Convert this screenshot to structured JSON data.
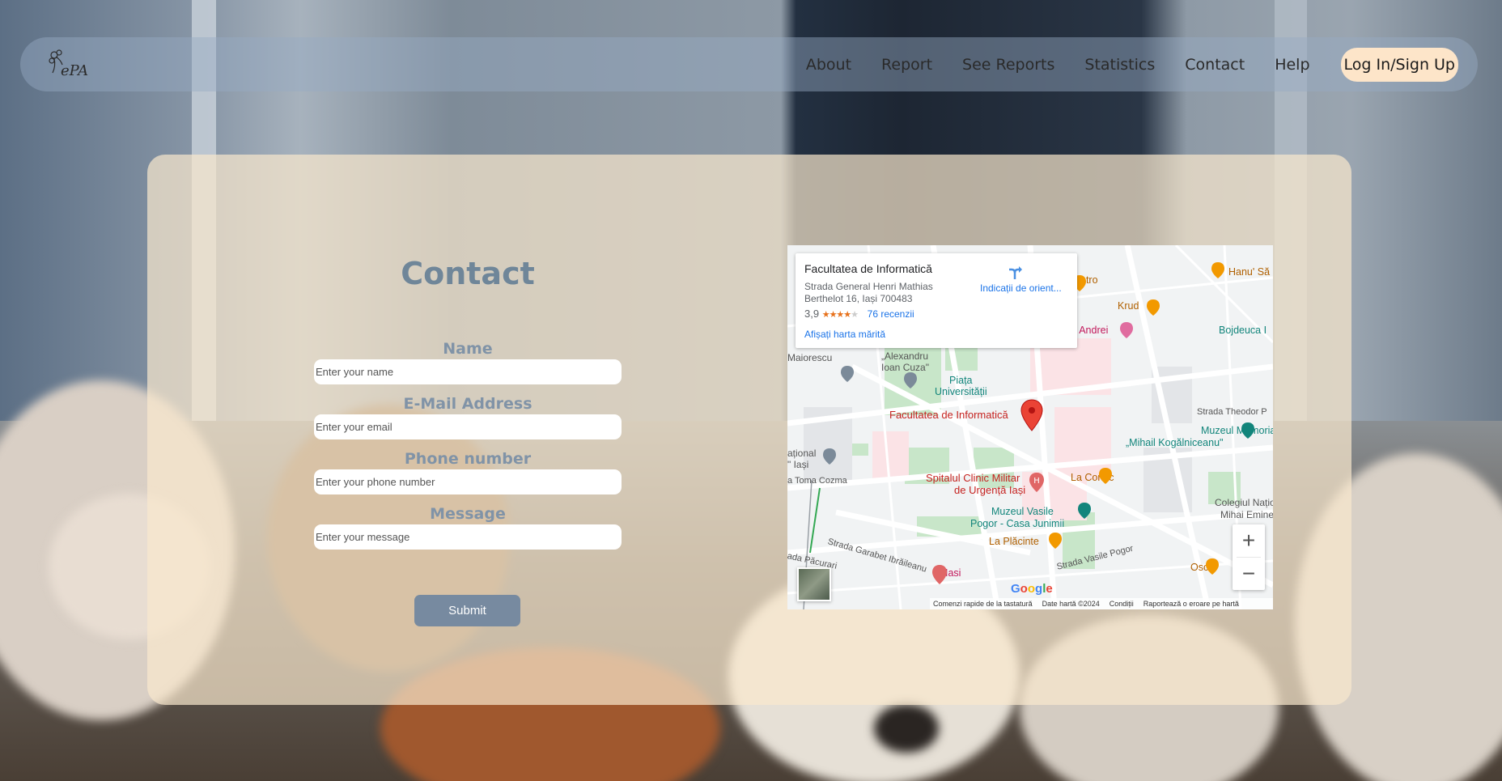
{
  "header": {
    "logo_text": "ePA",
    "nav": [
      "About",
      "Report",
      "See Reports",
      "Statistics",
      "Contact",
      "Help"
    ],
    "login_label": "Log In/Sign Up"
  },
  "contact": {
    "title": "Contact",
    "fields": [
      {
        "label": "Name",
        "placeholder": "Enter your name"
      },
      {
        "label": "E-Mail Address",
        "placeholder": "Enter your email"
      },
      {
        "label": "Phone number",
        "placeholder": "Enter your phone number"
      },
      {
        "label": "Message",
        "placeholder": "Enter your message"
      }
    ],
    "submit_label": "Submit"
  },
  "map": {
    "place_name": "Facultatea de Informatică",
    "address_line1": "Strada General Henri Mathias",
    "address_line2": "Berthelot 16, Iași 700483",
    "rating": "3,9",
    "stars": "★★★★",
    "stars_empty": "★",
    "reviews": "76 recenzii",
    "larger_map": "Afișați harta mărită",
    "directions": "Indicații de orient...",
    "labels": {
      "pin_label": "Facultatea de Informatică",
      "hostel": "Hostel Andrei",
      "krud": "Krud",
      "hanu": "Hanu' Să",
      "bojdeuca": "Bojdeuca I",
      "tro": "etro",
      "alexandru": "„Alexandru",
      "ioan_cuza": "Ioan Cuza\"",
      "piata": "Piața",
      "universitatii": "Universității",
      "maiorescu": "Maiorescu",
      "teodor": "Strada Theodor P",
      "muzeul_mem": "Muzeul Memorial",
      "kogalniceanu": "„Mihail Kogălniceanu\"",
      "national": "ațional",
      "iasi_l": "\" Iași",
      "toma_cozma": "a Toma Cozma",
      "spitalul": "Spitalul Clinic Militar",
      "urgenta": "de Urgență Iași",
      "la_conac": "La Conac",
      "colegiul": "Colegiul Național",
      "mihai_em": "Mihai Eminescu",
      "muzeul_vas": "Muzeul Vasile",
      "pogor": "Pogor - Casa Junimii",
      "garabet": "Strada Garabet Ibrăileanu",
      "placinte": "La Plăcinte",
      "pacurari": "ada Păcurari",
      "iasi": "Iasi",
      "vasile_pogor": "Strada Vasile Pogor",
      "oscar": "Oscar"
    },
    "zoom_in": "+",
    "zoom_out": "−",
    "google": "Google",
    "shortcuts": "Comenzi rapide de la tastatură",
    "map_data": "Date hartă ©2024",
    "terms": "Condiții",
    "report_error": "Raportează o eroare pe hartă"
  },
  "colors": {
    "card_bg": "#fae8cd",
    "title": "#6f8699",
    "submit_bg": "#778aa0",
    "login_bg": "#fde5c9",
    "pin": "#ea4335"
  }
}
